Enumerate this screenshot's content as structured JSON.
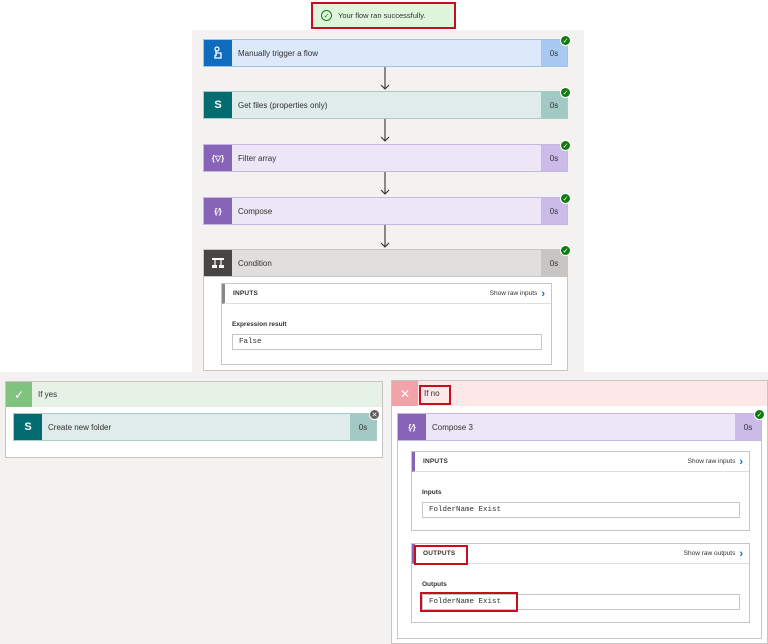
{
  "banner": {
    "text": "Your flow ran successfully."
  },
  "steps": [
    {
      "label": "Manually trigger a flow",
      "duration": "0s",
      "icon": "hand-tap-icon",
      "color": "#0f6cbd"
    },
    {
      "label": "Get files (properties only)",
      "duration": "0s",
      "icon": "sharepoint-icon",
      "color": "#036c70"
    },
    {
      "label": "Filter array",
      "duration": "0s",
      "icon": "filter-braces-icon",
      "color": "#8764b8"
    },
    {
      "label": "Compose",
      "duration": "0s",
      "icon": "compose-braces-icon",
      "color": "#8764b8"
    },
    {
      "label": "Condition",
      "duration": "0s",
      "icon": "condition-icon",
      "color": "#484644"
    }
  ],
  "condition": {
    "inputs_title": "INPUTS",
    "show_raw": "Show raw inputs",
    "field_label": "Expression result",
    "field_value": "False"
  },
  "if_yes": {
    "title": "If yes",
    "action_label": "Create new folder",
    "action_duration": "0s"
  },
  "if_no": {
    "title": "If no",
    "action_label": "Compose 3",
    "action_duration": "0s",
    "inputs_title": "INPUTS",
    "show_raw_inputs": "Show raw inputs",
    "inputs_field_label": "Inputs",
    "inputs_value": "FolderName Exist",
    "outputs_title": "OUTPUTS",
    "show_raw_outputs": "Show raw outputs",
    "outputs_field_label": "Outputs",
    "outputs_value": "FolderName Exist"
  },
  "colors": {
    "success": "#107c10",
    "highlight": "#c50f1f",
    "link": "#0f6cbd"
  }
}
